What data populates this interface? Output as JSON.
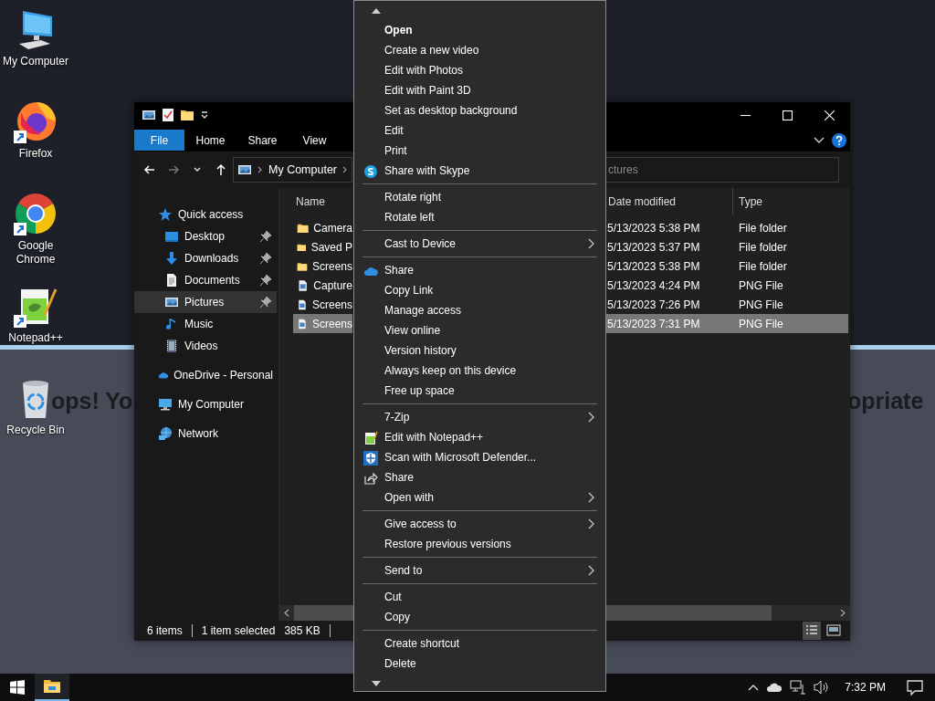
{
  "desktop_icons": [
    {
      "label": "My Computer",
      "shortcut": false
    },
    {
      "label": "Firefox",
      "shortcut": true
    },
    {
      "label": "Google Chrome",
      "shortcut": true
    },
    {
      "label": "Notepad++",
      "shortcut": true
    },
    {
      "label": "Recycle Bin",
      "shortcut": false
    }
  ],
  "background_window": {
    "texts": [
      "ops! Yo",
      "opriate"
    ]
  },
  "explorer": {
    "ribbon_tabs": [
      {
        "label": "File",
        "kind": "file"
      },
      {
        "label": "Home",
        "kind": "tab"
      },
      {
        "label": "Share",
        "kind": "tab"
      },
      {
        "label": "View",
        "kind": "tab"
      }
    ],
    "address": {
      "path": [
        "My Computer"
      ]
    },
    "search": {
      "placeholder": "ctures"
    },
    "nav": [
      {
        "label": "Quick access",
        "selected": false,
        "children": [
          {
            "label": "Desktop",
            "pinned": true,
            "selected": false
          },
          {
            "label": "Downloads",
            "pinned": true,
            "selected": false
          },
          {
            "label": "Documents",
            "pinned": true,
            "selected": false
          },
          {
            "label": "Pictures",
            "pinned": true,
            "selected": true
          },
          {
            "label": "Music",
            "pinned": false,
            "selected": false
          },
          {
            "label": "Videos",
            "pinned": false,
            "selected": false
          }
        ]
      },
      {
        "label": "OneDrive - Personal",
        "selected": false
      },
      {
        "label": "My Computer",
        "selected": false
      },
      {
        "label": "Network",
        "selected": false
      }
    ],
    "columns": [
      "Name",
      "Date modified",
      "Type"
    ],
    "rows": [
      {
        "name": "Camera",
        "kind": "folder",
        "date": "5/13/2023 5:38 PM",
        "type": "File folder",
        "selected": false
      },
      {
        "name": "Saved P",
        "kind": "folder",
        "date": "5/13/2023 5:37 PM",
        "type": "File folder",
        "selected": false
      },
      {
        "name": "Screens",
        "kind": "folder",
        "date": "5/13/2023 5:38 PM",
        "type": "File folder",
        "selected": false
      },
      {
        "name": "Capture",
        "kind": "image",
        "date": "5/13/2023 4:24 PM",
        "type": "PNG File",
        "selected": false
      },
      {
        "name": "Screens",
        "kind": "image",
        "date": "5/13/2023 7:26 PM",
        "type": "PNG File",
        "selected": false
      },
      {
        "name": "Screens",
        "kind": "image",
        "date": "5/13/2023 7:31 PM",
        "type": "PNG File",
        "selected": true
      }
    ],
    "status": {
      "count": "6 items",
      "selection": "1 item selected",
      "size": "385 KB"
    },
    "views": [
      {
        "selected": true
      },
      {
        "selected": false
      }
    ]
  },
  "context_menu": {
    "items": [
      {
        "kind": "item",
        "label": "Open",
        "default": true
      },
      {
        "kind": "item",
        "label": "Create a new video"
      },
      {
        "kind": "item",
        "label": "Edit with Photos"
      },
      {
        "kind": "item",
        "label": "Edit with Paint 3D"
      },
      {
        "kind": "item",
        "label": "Set as desktop background"
      },
      {
        "kind": "item",
        "label": "Edit"
      },
      {
        "kind": "item",
        "label": "Print"
      },
      {
        "kind": "item",
        "label": "Share with Skype"
      },
      {
        "kind": "separator"
      },
      {
        "kind": "item",
        "label": "Rotate right"
      },
      {
        "kind": "item",
        "label": "Rotate left"
      },
      {
        "kind": "separator"
      },
      {
        "kind": "submenu",
        "label": "Cast to Device"
      },
      {
        "kind": "separator"
      },
      {
        "kind": "item",
        "label": "Share"
      },
      {
        "kind": "item",
        "label": "Copy Link"
      },
      {
        "kind": "item",
        "label": "Manage access"
      },
      {
        "kind": "item",
        "label": "View online"
      },
      {
        "kind": "item",
        "label": "Version history"
      },
      {
        "kind": "item",
        "label": "Always keep on this device"
      },
      {
        "kind": "item",
        "label": "Free up space"
      },
      {
        "kind": "separator"
      },
      {
        "kind": "submenu",
        "label": "7-Zip"
      },
      {
        "kind": "item",
        "label": "Edit with Notepad++"
      },
      {
        "kind": "item",
        "label": "Scan with Microsoft Defender..."
      },
      {
        "kind": "item",
        "label": "Share"
      },
      {
        "kind": "submenu",
        "label": "Open with"
      },
      {
        "kind": "separator"
      },
      {
        "kind": "submenu",
        "label": "Give access to"
      },
      {
        "kind": "item",
        "label": "Restore previous versions"
      },
      {
        "kind": "separator"
      },
      {
        "kind": "submenu",
        "label": "Send to"
      },
      {
        "kind": "separator"
      },
      {
        "kind": "item",
        "label": "Cut"
      },
      {
        "kind": "item",
        "label": "Copy"
      },
      {
        "kind": "separator"
      },
      {
        "kind": "item",
        "label": "Create shortcut"
      },
      {
        "kind": "item",
        "label": "Delete"
      }
    ]
  },
  "taskbar": {
    "apps": [
      {
        "active": true
      }
    ],
    "time": "7:32 PM"
  }
}
